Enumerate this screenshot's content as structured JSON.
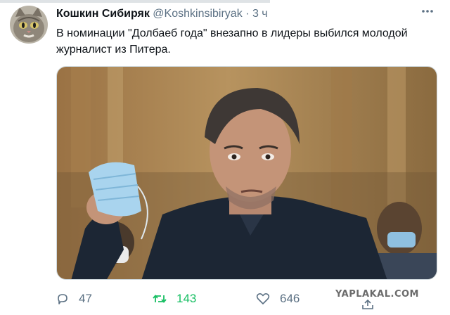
{
  "tweet": {
    "display_name": "Кошкин Сибиряк",
    "handle": "@Koshkinsibiryak",
    "separator": "·",
    "timestamp": "3 ч",
    "text": "В номинации \"Долбаеб года\" внезапно в лидеры выбился молодой журналист из Питера."
  },
  "icons": {
    "avatar": "cat-avatar",
    "more": "more-icon",
    "reply": "reply-icon",
    "retweet": "retweet-icon",
    "like": "heart-icon",
    "share": "share-icon"
  },
  "actions": {
    "reply_count": "47",
    "retweet_count": "143",
    "like_count": "646"
  },
  "watermark": "YAPLAKAL.COM",
  "colors": {
    "text": "#0f1419",
    "secondary": "#5b7083",
    "retweet_active": "#17bf63"
  }
}
